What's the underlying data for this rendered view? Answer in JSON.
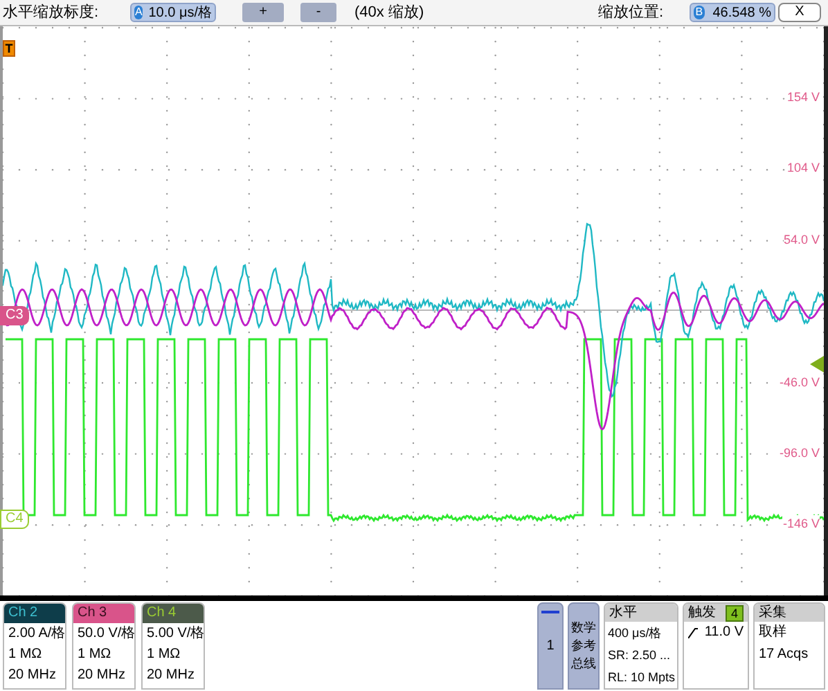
{
  "zoom_bar": {
    "scale_label": "水平缩放标度:",
    "scale_knob": "A",
    "scale_value": "10.0 μs/格",
    "plus": "+",
    "minus": "-",
    "zoom_factor": "(40x 缩放)",
    "position_label": "缩放位置:",
    "position_knob": "B",
    "position_value": "46.548 %",
    "close": "X"
  },
  "plot": {
    "trigger_marker": "T",
    "channel_markers": [
      {
        "label": "C3",
        "kind": "filled",
        "color": "#d9548a"
      },
      {
        "label": "C4",
        "kind": "outline",
        "color": "#9acd32"
      }
    ],
    "y_labels": [
      "154 V",
      "104 V",
      "54.0 V",
      "-46.0 V",
      "-96.0 V",
      "-146 V"
    ]
  },
  "channels": [
    {
      "name": "Ch 2",
      "color": "#0e3d4a",
      "lines": [
        "2.00 A/格",
        "1 MΩ",
        "20 MHz"
      ]
    },
    {
      "name": "Ch 3",
      "color": "#d9548a",
      "lines": [
        "50.0 V/格",
        "1 MΩ",
        "20 MHz"
      ]
    },
    {
      "name": "Ch 4",
      "color": "#4c5a4a",
      "lines": [
        "5.00 V/格",
        "1 MΩ",
        "20 MHz"
      ]
    }
  ],
  "ref_button": "1",
  "menu_button": [
    "数学",
    "参考",
    "总线"
  ],
  "horizontal": {
    "title": "水平",
    "lines": [
      "400 μs/格",
      "SR: 2.50 ...",
      "RL: 10 Mpts"
    ]
  },
  "trigger": {
    "title": "触发",
    "source": "4",
    "level": "11.0 V"
  },
  "acquisition": {
    "title": "采集",
    "lines": [
      "取样",
      "17 Acqs"
    ]
  }
}
